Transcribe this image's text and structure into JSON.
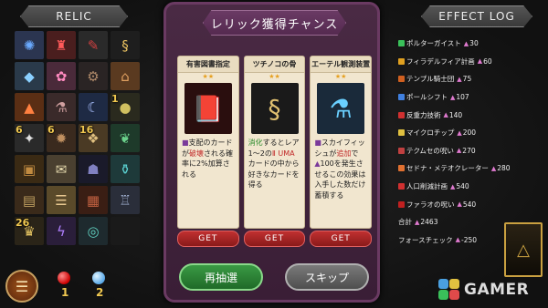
{
  "relic_panel": {
    "title": "RELIC",
    "relics": [
      {
        "icon": "electric-skull-icon",
        "bg": "#2b3550",
        "fg": "#6aaaff",
        "glyph": "✺",
        "badge": ""
      },
      {
        "icon": "red-tower-icon",
        "bg": "#4a1e1e",
        "fg": "#ff5a5a",
        "glyph": "♜",
        "badge": ""
      },
      {
        "icon": "syringe-icon",
        "bg": "#2a2a2a",
        "fg": "#d04040",
        "glyph": "✎",
        "badge": ""
      },
      {
        "icon": "golden-serpent-icon",
        "bg": "#1e1e1e",
        "fg": "#e8c060",
        "glyph": "§",
        "badge": ""
      },
      {
        "icon": "crystal-terrain-icon",
        "bg": "#2a3a4a",
        "fg": "#8ad0ff",
        "glyph": "◆",
        "badge": ""
      },
      {
        "icon": "pink-shrine-icon",
        "bg": "#4a2a3a",
        "fg": "#ff8ac0",
        "glyph": "✿",
        "badge": ""
      },
      {
        "icon": "dark-machine-icon",
        "bg": "#2a2424",
        "fg": "#b08a6a",
        "glyph": "⚙",
        "badge": ""
      },
      {
        "icon": "desert-town-icon",
        "bg": "#5a3a20",
        "fg": "#e0a060",
        "glyph": "⌂",
        "badge": ""
      },
      {
        "icon": "orange-mesa-icon",
        "bg": "#5a2e14",
        "fg": "#ff8040",
        "glyph": "▲",
        "badge": ""
      },
      {
        "icon": "lab-scene-icon",
        "bg": "#3a2a2a",
        "fg": "#d0a0a0",
        "glyph": "⚗",
        "badge": ""
      },
      {
        "icon": "moon-tower-icon",
        "bg": "#1e2a44",
        "fg": "#aac0ff",
        "glyph": "☾",
        "badge": ""
      },
      {
        "icon": "yellow-cell-icon",
        "bg": "#2a2a1e",
        "fg": "#d0c060",
        "glyph": "●",
        "badge": "1"
      },
      {
        "icon": "spotlight-icon",
        "bg": "#2a2a2a",
        "fg": "#e0e0e0",
        "glyph": "✦",
        "badge": "6"
      },
      {
        "icon": "gear-wheel-icon",
        "bg": "#3a2a1e",
        "fg": "#c09060",
        "glyph": "✹",
        "badge": "6"
      },
      {
        "icon": "ancient-map-icon",
        "bg": "#4a3a24",
        "fg": "#e0c080",
        "glyph": "❖",
        "badge": "16"
      },
      {
        "icon": "green-plant-icon",
        "bg": "#1e3a2a",
        "fg": "#6ad08a",
        "glyph": "❦",
        "badge": ""
      },
      {
        "icon": "treasure-chest-icon",
        "bg": "#3a2a14",
        "fg": "#c08a40",
        "glyph": "▣",
        "badge": ""
      },
      {
        "icon": "scroll-icon",
        "bg": "#4a4030",
        "fg": "#e8dcb0",
        "glyph": "✉",
        "badge": ""
      },
      {
        "icon": "night-city-icon",
        "bg": "#1a1a2a",
        "fg": "#8080c0",
        "glyph": "☗",
        "badge": ""
      },
      {
        "icon": "potion-shelf-icon",
        "bg": "#1e3a3a",
        "fg": "#5ad0d0",
        "glyph": "⚱",
        "badge": ""
      },
      {
        "icon": "wooden-sign-icon",
        "bg": "#3a2a1a",
        "fg": "#c0a060",
        "glyph": "▤",
        "badge": ""
      },
      {
        "icon": "parchment-icon",
        "bg": "#5a4a2a",
        "fg": "#e8c890",
        "glyph": "☰",
        "badge": ""
      },
      {
        "icon": "wooden-crate-icon",
        "bg": "#3a1e14",
        "fg": "#c06040",
        "glyph": "▦",
        "badge": ""
      },
      {
        "icon": "castle-icon",
        "bg": "#2a2e3a",
        "fg": "#a0b0d0",
        "glyph": "♖",
        "badge": ""
      },
      {
        "icon": "golden-statue-icon",
        "bg": "#2a2418",
        "fg": "#e0c060",
        "glyph": "♛",
        "badge": "26"
      },
      {
        "icon": "lightning-storm-icon",
        "bg": "#2a1e3a",
        "fg": "#b080ff",
        "glyph": "ϟ",
        "badge": ""
      },
      {
        "icon": "portal-icon",
        "bg": "#1e2a2e",
        "fg": "#60d0c0",
        "glyph": "◎",
        "badge": ""
      },
      {
        "icon": "empty-slot-icon",
        "bg": "#1a1a1a",
        "fg": "#555",
        "glyph": "",
        "badge": ""
      }
    ]
  },
  "inventory": {
    "red_gem_count": "1",
    "blue_gem_count": "2",
    "colors": {
      "red": "#cc0000",
      "blue": "#58a8e8",
      "count": "#f0c850"
    }
  },
  "dialog": {
    "title": "レリック獲得チャンス",
    "cards": [
      {
        "name": "有害図書指定",
        "stars": "★★",
        "art_icon": "cursed-book-icon",
        "art_bg": "#2a0e0e",
        "art_fg": "#c04a2a",
        "art_glyph": "📕",
        "desc_parts": [
          {
            "text": "■",
            "cls": "hl-p"
          },
          {
            "text": "支配のカードが",
            "cls": ""
          },
          {
            "text": "破壊",
            "cls": "hl-r"
          },
          {
            "text": "される確率に2%加算される",
            "cls": ""
          }
        ]
      },
      {
        "name": "ツチノコの骨",
        "stars": "★★",
        "art_icon": "serpent-skeleton-icon",
        "art_bg": "#1a1a1a",
        "art_fg": "#e0c070",
        "art_glyph": "§",
        "desc_parts": [
          {
            "text": "消化",
            "cls": "hl-g"
          },
          {
            "text": "するとレア1〜2の",
            "cls": ""
          },
          {
            "text": "Ⅱ UMA",
            "cls": "hl-r"
          },
          {
            "text": "カードの中から好きなカードを得る",
            "cls": ""
          }
        ]
      },
      {
        "name": "エーテル観測装置",
        "stars": "★★",
        "art_icon": "ether-device-icon",
        "art_bg": "#1a2a3a",
        "art_fg": "#6ad0ff",
        "art_glyph": "⚗",
        "desc_parts": [
          {
            "text": "■",
            "cls": "hl-p"
          },
          {
            "text": "スカイフィッシュが",
            "cls": ""
          },
          {
            "text": "追加",
            "cls": "hl-r"
          },
          {
            "text": "で",
            "cls": ""
          },
          {
            "text": "▲",
            "cls": "hl-p"
          },
          {
            "text": "100を発生させる",
            "cls": ""
          },
          {
            "text": "この効果は入手した数だけ蓄積する",
            "cls": ""
          }
        ]
      }
    ],
    "get_label": "GET",
    "reroll_label": "再抽選",
    "skip_label": "スキップ"
  },
  "effect_log": {
    "title": "EFFECT LOG",
    "rows": [
      {
        "icon_color": "#3ac05a",
        "name": "ポルターガイスト",
        "value": "30"
      },
      {
        "icon_color": "#e0a020",
        "name": "フィラデルフィア計画",
        "value": "60"
      },
      {
        "icon_color": "#d06020",
        "name": "テンプル騎士団",
        "value": "75"
      },
      {
        "icon_color": "#4080e0",
        "name": "ポールシフト",
        "value": "107"
      },
      {
        "icon_color": "#d03030",
        "name": "反重力技術",
        "value": "140"
      },
      {
        "icon_color": "#e0c040",
        "name": "マイクロチップ",
        "value": "200"
      },
      {
        "icon_color": "#c04040",
        "name": "テクムセの呪い",
        "value": "270"
      },
      {
        "icon_color": "#e07030",
        "name": "セドナ・メテオクレーター",
        "value": "280"
      },
      {
        "icon_color": "#d03030",
        "name": "人口削減計画",
        "value": "540"
      },
      {
        "icon_color": "#c02020",
        "name": "ファラオの呪い",
        "value": "540"
      }
    ],
    "total_label": "合計",
    "total_value": "2463",
    "force_label": "フォースチェック",
    "force_value": "-250",
    "accent": "#e07ad0"
  },
  "watermark": {
    "text": "GAMER"
  }
}
